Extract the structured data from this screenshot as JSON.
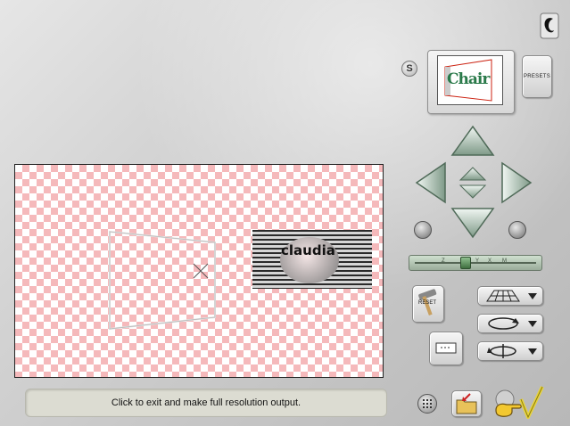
{
  "status": {
    "message": "Click to exit and make full resolution output."
  },
  "presets": {
    "label": "PRESETS",
    "thumbnail_text": "Chair"
  },
  "controls": {
    "s_button_label": "S",
    "reset_label": "RESET",
    "slider_ticks": [
      "Z",
      "Y",
      "X",
      "M"
    ],
    "slider_value": 0.42
  },
  "canvas": {
    "watermark_text": "claudia"
  },
  "icons": {
    "help": "help-icon",
    "move_up": "arrow-up-icon",
    "move_down": "arrow-down-icon",
    "move_left": "arrow-left-icon",
    "move_right": "arrow-right-icon",
    "rotate_left": "rotate-left-icon",
    "rotate_right": "rotate-right-icon",
    "perspective": "perspective-grid-icon",
    "rotate_circle": "rotate-circle-icon",
    "flip_axis": "flip-axis-icon",
    "crop": "crop-rectangle-icon",
    "grid": "grid-icon",
    "open": "open-folder-icon",
    "ok": "pointing-hand-checkmark-icon"
  },
  "colors": {
    "checker_pink": "#f5b9bb",
    "arrow_green": "#9fb4a7",
    "ok_check": "#e8d43a"
  }
}
